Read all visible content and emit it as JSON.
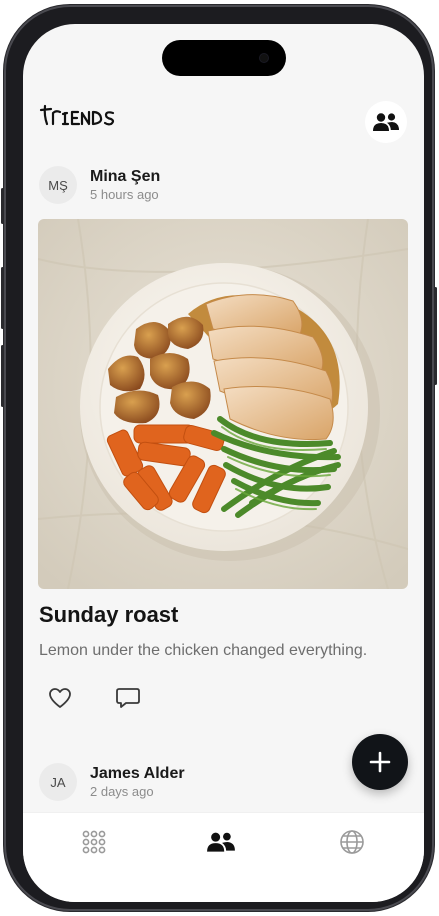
{
  "app": {
    "logo_text": "friends"
  },
  "header": {
    "friends_button_icon": "people-icon"
  },
  "feed": {
    "posts": [
      {
        "avatar_initials": "MŞ",
        "author": "Mina Şen",
        "time": "5 hours ago",
        "title": "Sunday roast",
        "caption": "Lemon under the chicken changed everything.",
        "photo": "plate of sliced roast chicken with gravy, roasted potatoes, carrots and green beans"
      },
      {
        "avatar_initials": "JA",
        "author": "James Alder",
        "time": "2 days ago"
      }
    ],
    "actions": {
      "like_icon": "heart-icon",
      "comment_icon": "comment-icon"
    },
    "fab_icon": "plus-icon"
  },
  "tabbar": {
    "tabs": [
      {
        "icon": "grid-icon",
        "active": false
      },
      {
        "icon": "people-icon",
        "active": true
      },
      {
        "icon": "globe-icon",
        "active": false
      }
    ]
  },
  "colors": {
    "background": "#f6f6f6",
    "primary": "#111418",
    "muted": "#8c8c8c"
  }
}
